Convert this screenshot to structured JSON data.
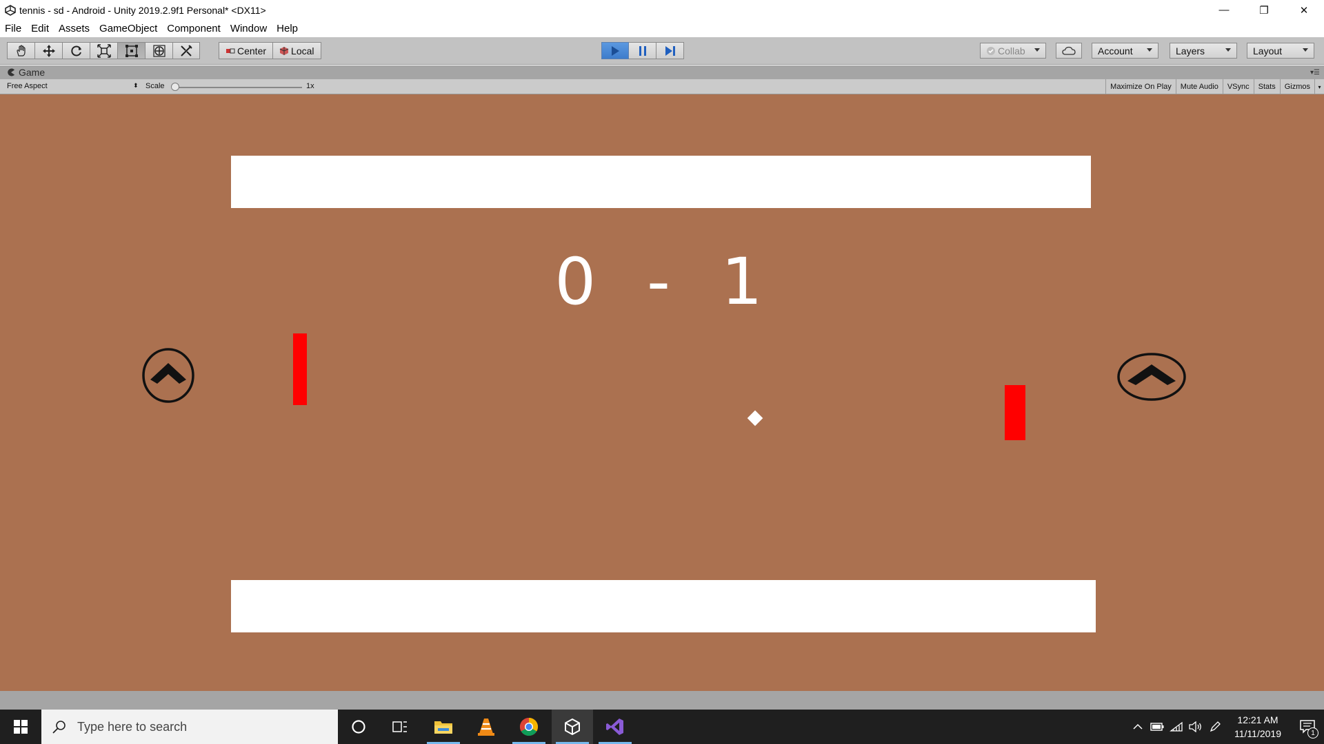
{
  "window": {
    "title": "tennis - sd - Android - Unity 2019.2.9f1 Personal* <DX11>",
    "minimize": "—",
    "restore": "❐",
    "close": "✕"
  },
  "menu": [
    "File",
    "Edit",
    "Assets",
    "GameObject",
    "Component",
    "Window",
    "Help"
  ],
  "toolbar": {
    "tools": [
      "hand-tool-icon",
      "move-tool-icon",
      "rotate-tool-icon",
      "scale-tool-icon",
      "rect-tool-icon",
      "transform-tool-icon",
      "custom-tool-icon"
    ],
    "pivot_mode": "Center",
    "pivot_rotation": "Local",
    "collab": "Collab",
    "account": "Account",
    "layers": "Layers",
    "layout": "Layout"
  },
  "game_panel": {
    "tab_label": "Game",
    "aspect": "Free Aspect",
    "scale_label": "Scale",
    "scale_value": "1x",
    "toggles": [
      "Maximize On Play",
      "Mute Audio",
      "VSync",
      "Stats",
      "Gizmos"
    ]
  },
  "game": {
    "score_left": "0",
    "score_separator": "-",
    "score_right": "1",
    "background_color": "#ab7150",
    "paddle_color": "#ff0000"
  },
  "taskbar": {
    "search_placeholder": "Type here to search",
    "apps": [
      "cortana-icon",
      "task-view-icon",
      "file-explorer-icon",
      "vlc-icon",
      "chrome-icon",
      "unity-icon",
      "visual-studio-icon"
    ],
    "time": "12:21 AM",
    "date": "11/11/2019",
    "notification_count": "1"
  }
}
